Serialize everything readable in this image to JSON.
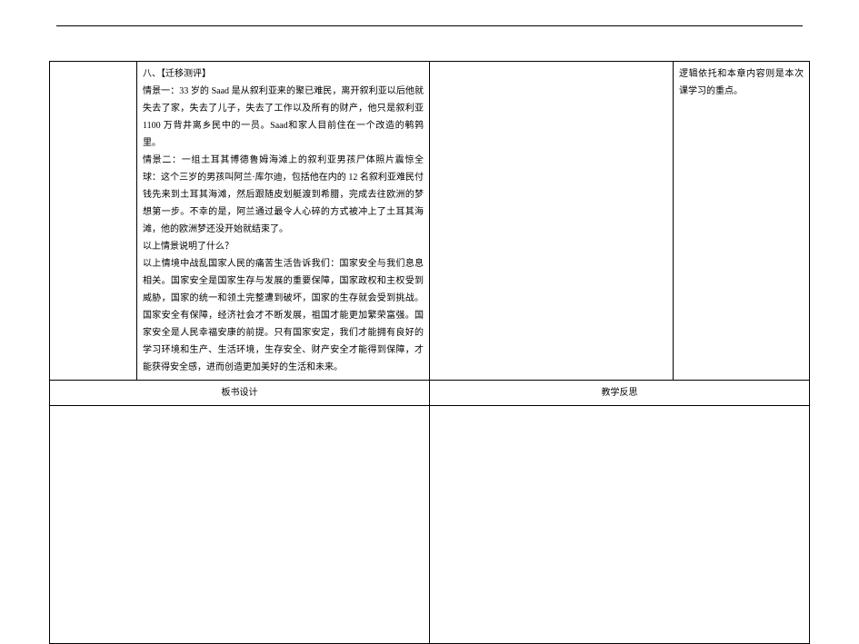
{
  "upper": {
    "left_blank": "",
    "main": "八、【迁移测评】\n情景一：33 岁的 Saad 是从叙利亚来的聚已难民，离开叙利亚以后他就失去了家，失去了儿子，失去了工作以及所有的财产，他只是叙利亚 1100 万背井离乡民中的一员。Saad和家人目前住在一个改造的鹌鹑里。\n情景二：一组土耳其博德鲁姆海滩上的叙利亚男孩尸体照片震惊全球：这个三岁的男孩叫阿兰·库尔迪，包括他在内的 12 名叙利亚难民付钱先来到土耳其海滩，然后跟随皮划艇渡到希腊，完成去往欧洲的梦想第一步。不幸的是，阿兰通过最令人心碎的方式被冲上了土耳其海滩，他的欧洲梦还没开始就结束了。\n以上情景说明了什么？\n以上情境中战乱国家人民的痛苦生活告诉我们：国家安全与我们息息相关。国家安全是国家生存与发展的重要保障，国家政权和主权受到威胁，国家的统一和领土完整遭到破坏，国家的生存就会受到挑战。国家安全有保障，经济社会才不断发展，祖国才能更加繁荣富强。国家安全是人民幸福安康的前提。只有国家安定，我们才能拥有良好的学习环境和生产、生活环境，生存安全、财产安全才能得到保障，才能获得安全感，进而创造更加美好的生活和未来。",
    "mid_blank": "",
    "right": "逻辑依托和本章内容则是本次课学习的重点。"
  },
  "headers": {
    "design_left": "板书设计",
    "reflect_right": "教学反思"
  }
}
